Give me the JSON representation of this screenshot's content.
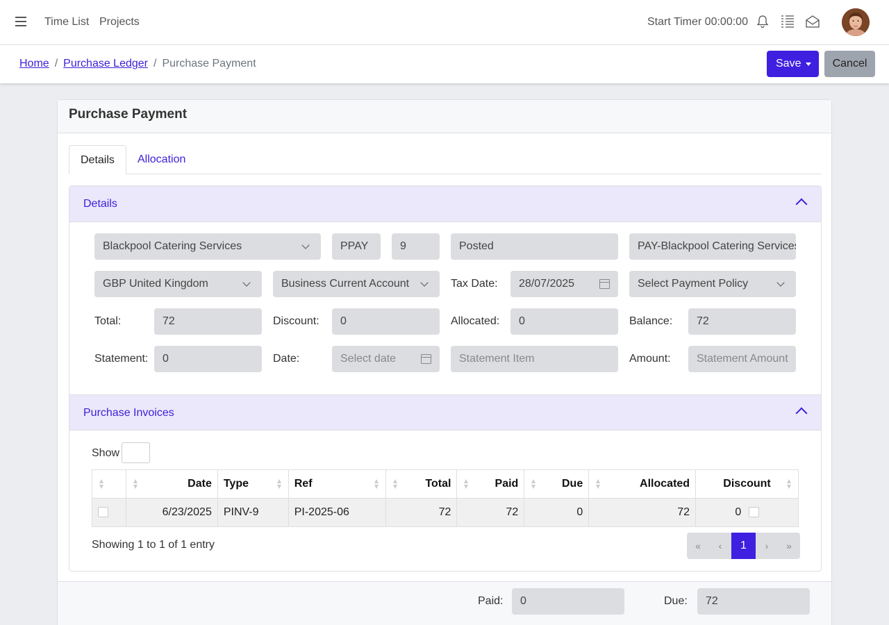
{
  "nav": {
    "time_list": "Time List",
    "projects": "Projects",
    "timer": "Start Timer 00:00:00"
  },
  "breadcrumb": {
    "home": "Home",
    "ledger": "Purchase Ledger",
    "current": "Purchase Payment"
  },
  "actions": {
    "save": "Save",
    "cancel": "Cancel"
  },
  "card": {
    "title": "Purchase Payment"
  },
  "tabs": [
    "Details",
    "Allocation"
  ],
  "details": {
    "header": "Details",
    "supplier": "Blackpool Catering Services",
    "type": "PPAY",
    "number": "9",
    "status": "Posted",
    "reference": "PAY-Blackpool Catering Services",
    "currency": "GBP United Kingdom",
    "bank_account": "Business Current Account",
    "tax_date_label": "Tax Date:",
    "tax_date": "28/07/2025",
    "payment_policy": "Select Payment Policy",
    "total_label": "Total:",
    "total": "72",
    "discount_label": "Discount:",
    "discount": "0",
    "allocated_label": "Allocated:",
    "allocated": "0",
    "balance_label": "Balance:",
    "balance": "72",
    "statement_label": "Statement:",
    "statement": "0",
    "date_label": "Date:",
    "date_placeholder": "Select date",
    "statement_item_placeholder": "Statement Item",
    "amount_label": "Amount:",
    "amount_placeholder": "Statement Amount"
  },
  "invoices": {
    "header": "Purchase Invoices",
    "show_label": "Show",
    "columns": [
      "",
      "Date",
      "Type",
      "Ref",
      "Total",
      "Paid",
      "Due",
      "Allocated",
      "Discount"
    ],
    "rows": [
      {
        "date": "6/23/2025",
        "type": "PINV-9",
        "ref": "PI-2025-06",
        "total": "72",
        "paid": "72",
        "due": "0",
        "allocated": "72",
        "discount": "0"
      }
    ],
    "info": "Showing 1 to 1 of 1 entry",
    "pager": {
      "first": "«",
      "prev": "‹",
      "current": "1",
      "next": "›",
      "last": "»"
    }
  },
  "footer": {
    "paid_label": "Paid:",
    "paid": "0",
    "due_label": "Due:",
    "due": "72"
  }
}
